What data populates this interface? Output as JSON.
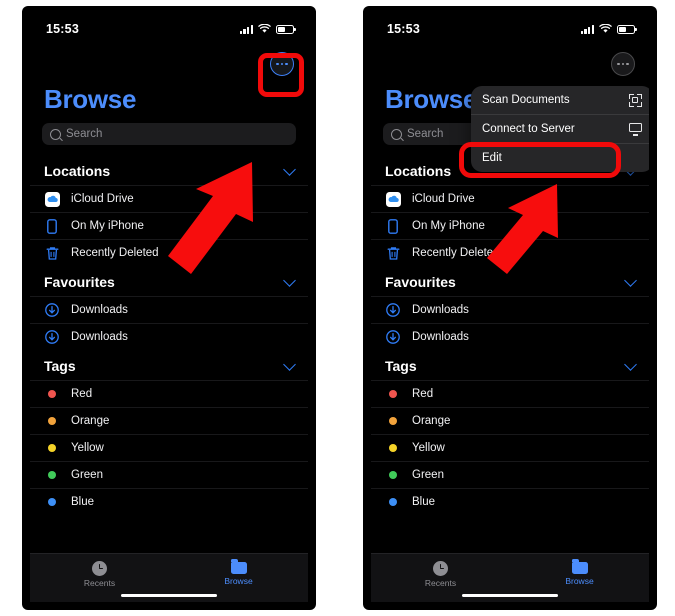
{
  "status_bar": {
    "time": "15:53",
    "signal_icon": "cellular-signal-icon",
    "wifi_icon": "wifi-icon",
    "battery_icon": "battery-icon"
  },
  "colors": {
    "accent_blue": "#4c8dfc",
    "highlight_red": "#f10a0a",
    "screen_bg": "#000000",
    "menu_bg": "#262628",
    "search_bg": "#1c1c1e",
    "tag_red": "#f0554f",
    "tag_orange": "#f2a33c",
    "tag_yellow": "#f5d328",
    "tag_green": "#41cb5a",
    "tag_blue": "#3d8ff5"
  },
  "nav": {
    "more_button_label": "More",
    "more_icon": "ellipsis-circle-icon"
  },
  "title": "Browse",
  "search": {
    "placeholder": "Search",
    "icon": "search-icon"
  },
  "sections": [
    {
      "id": "locations",
      "header": "Locations",
      "chevron_icon": "chevron-down-icon",
      "items": [
        {
          "label": "iCloud Drive",
          "icon": "icloud-drive-icon"
        },
        {
          "label": "On My iPhone",
          "icon": "iphone-icon"
        },
        {
          "label": "Recently Deleted",
          "icon": "trash-icon"
        }
      ]
    },
    {
      "id": "favourites",
      "header": "Favourites",
      "chevron_icon": "chevron-down-icon",
      "items": [
        {
          "label": "Downloads",
          "icon": "download-circle-icon"
        },
        {
          "label": "Downloads",
          "icon": "download-circle-icon"
        }
      ]
    },
    {
      "id": "tags",
      "header": "Tags",
      "chevron_icon": "chevron-down-icon",
      "items": [
        {
          "label": "Red",
          "icon": "tag-dot-icon",
          "color": "#f0554f"
        },
        {
          "label": "Orange",
          "icon": "tag-dot-icon",
          "color": "#f2a33c"
        },
        {
          "label": "Yellow",
          "icon": "tag-dot-icon",
          "color": "#f5d328"
        },
        {
          "label": "Green",
          "icon": "tag-dot-icon",
          "color": "#41cb5a"
        },
        {
          "label": "Blue",
          "icon": "tag-dot-icon",
          "color": "#3d8ff5"
        }
      ]
    }
  ],
  "tabbar": {
    "tabs": [
      {
        "label": "Recents",
        "icon": "clock-icon",
        "active": false
      },
      {
        "label": "Browse",
        "icon": "folder-icon",
        "active": true
      }
    ]
  },
  "context_menu": {
    "items": [
      {
        "label": "Scan Documents",
        "icon": "document-scanner-icon",
        "highlighted": false
      },
      {
        "label": "Connect to Server",
        "icon": "monitor-icon",
        "highlighted": false
      },
      {
        "label": "Edit",
        "icon": "",
        "highlighted": true
      }
    ]
  },
  "annotations": {
    "left_panel": {
      "highlight_target": "more-button",
      "arrow": "red-arrow-up-right"
    },
    "right_panel": {
      "highlight_target": "menu-item-edit",
      "arrow": "red-arrow-up-right"
    }
  }
}
